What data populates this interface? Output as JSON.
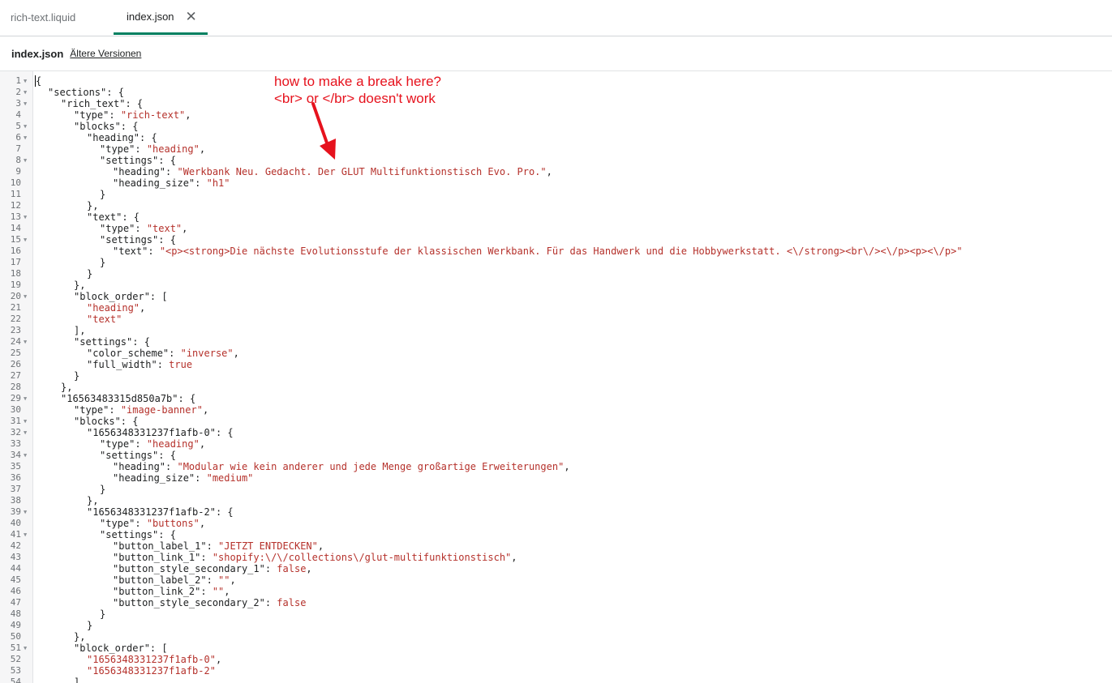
{
  "tabs": [
    {
      "label": "rich-text.liquid",
      "active": false
    },
    {
      "label": "index.json",
      "active": true,
      "close_icon": "close-icon"
    }
  ],
  "filebar": {
    "file_name": "index.json",
    "older_versions_link": "Ältere Versionen"
  },
  "annotation": {
    "line1": "how to make a break here?",
    "line2": "<br> or </br> doesn't work",
    "color": "#e6121d"
  },
  "editor": {
    "lines": [
      {
        "n": "1",
        "fold": true,
        "i": 0,
        "t": [
          [
            "p",
            "{"
          ]
        ]
      },
      {
        "n": "2",
        "fold": true,
        "i": 1,
        "t": [
          [
            "k",
            "\"sections\""
          ],
          [
            "p",
            ": {"
          ]
        ]
      },
      {
        "n": "3",
        "fold": true,
        "i": 2,
        "t": [
          [
            "k",
            "\"rich_text\""
          ],
          [
            "p",
            ": {"
          ]
        ]
      },
      {
        "n": "4",
        "fold": false,
        "i": 3,
        "t": [
          [
            "k",
            "\"type\""
          ],
          [
            "p",
            ": "
          ],
          [
            "s",
            "\"rich-text\""
          ],
          [
            "p",
            ","
          ]
        ]
      },
      {
        "n": "5",
        "fold": true,
        "i": 3,
        "t": [
          [
            "k",
            "\"blocks\""
          ],
          [
            "p",
            ": {"
          ]
        ]
      },
      {
        "n": "6",
        "fold": true,
        "i": 4,
        "t": [
          [
            "k",
            "\"heading\""
          ],
          [
            "p",
            ": {"
          ]
        ]
      },
      {
        "n": "7",
        "fold": false,
        "i": 5,
        "t": [
          [
            "k",
            "\"type\""
          ],
          [
            "p",
            ": "
          ],
          [
            "s",
            "\"heading\""
          ],
          [
            "p",
            ","
          ]
        ]
      },
      {
        "n": "8",
        "fold": true,
        "i": 5,
        "t": [
          [
            "k",
            "\"settings\""
          ],
          [
            "p",
            ": {"
          ]
        ]
      },
      {
        "n": "9",
        "fold": false,
        "i": 6,
        "t": [
          [
            "k",
            "\"heading\""
          ],
          [
            "p",
            ": "
          ],
          [
            "s",
            "\"Werkbank Neu. Gedacht. Der GLUT Multifunktionstisch Evo. Pro.\""
          ],
          [
            "p",
            ","
          ]
        ]
      },
      {
        "n": "10",
        "fold": false,
        "i": 6,
        "t": [
          [
            "k",
            "\"heading_size\""
          ],
          [
            "p",
            ": "
          ],
          [
            "s",
            "\"h1\""
          ]
        ]
      },
      {
        "n": "11",
        "fold": false,
        "i": 5,
        "t": [
          [
            "p",
            "}"
          ]
        ]
      },
      {
        "n": "12",
        "fold": false,
        "i": 4,
        "t": [
          [
            "p",
            "},"
          ]
        ]
      },
      {
        "n": "13",
        "fold": true,
        "i": 4,
        "t": [
          [
            "k",
            "\"text\""
          ],
          [
            "p",
            ": {"
          ]
        ]
      },
      {
        "n": "14",
        "fold": false,
        "i": 5,
        "t": [
          [
            "k",
            "\"type\""
          ],
          [
            "p",
            ": "
          ],
          [
            "s",
            "\"text\""
          ],
          [
            "p",
            ","
          ]
        ]
      },
      {
        "n": "15",
        "fold": true,
        "i": 5,
        "t": [
          [
            "k",
            "\"settings\""
          ],
          [
            "p",
            ": {"
          ]
        ]
      },
      {
        "n": "16",
        "fold": false,
        "i": 6,
        "t": [
          [
            "k",
            "\"text\""
          ],
          [
            "p",
            ": "
          ],
          [
            "s",
            "\"<p><strong>Die nächste Evolutionsstufe der klassischen Werkbank. Für das Handwerk und die Hobbywerkstatt. <\\/strong><br\\/><\\/p><p><\\/p>\""
          ]
        ]
      },
      {
        "n": "17",
        "fold": false,
        "i": 5,
        "t": [
          [
            "p",
            "}"
          ]
        ]
      },
      {
        "n": "18",
        "fold": false,
        "i": 4,
        "t": [
          [
            "p",
            "}"
          ]
        ]
      },
      {
        "n": "19",
        "fold": false,
        "i": 3,
        "t": [
          [
            "p",
            "},"
          ]
        ]
      },
      {
        "n": "20",
        "fold": true,
        "i": 3,
        "t": [
          [
            "k",
            "\"block_order\""
          ],
          [
            "p",
            ": ["
          ]
        ]
      },
      {
        "n": "21",
        "fold": false,
        "i": 4,
        "t": [
          [
            "s",
            "\"heading\""
          ],
          [
            "p",
            ","
          ]
        ]
      },
      {
        "n": "22",
        "fold": false,
        "i": 4,
        "t": [
          [
            "s",
            "\"text\""
          ]
        ]
      },
      {
        "n": "23",
        "fold": false,
        "i": 3,
        "t": [
          [
            "p",
            "],"
          ]
        ]
      },
      {
        "n": "24",
        "fold": true,
        "i": 3,
        "t": [
          [
            "k",
            "\"settings\""
          ],
          [
            "p",
            ": {"
          ]
        ]
      },
      {
        "n": "25",
        "fold": false,
        "i": 4,
        "t": [
          [
            "k",
            "\"color_scheme\""
          ],
          [
            "p",
            ": "
          ],
          [
            "s",
            "\"inverse\""
          ],
          [
            "p",
            ","
          ]
        ]
      },
      {
        "n": "26",
        "fold": false,
        "i": 4,
        "t": [
          [
            "k",
            "\"full_width\""
          ],
          [
            "p",
            ": "
          ],
          [
            "kw",
            "true"
          ]
        ]
      },
      {
        "n": "27",
        "fold": false,
        "i": 3,
        "t": [
          [
            "p",
            "}"
          ]
        ]
      },
      {
        "n": "28",
        "fold": false,
        "i": 2,
        "t": [
          [
            "p",
            "},"
          ]
        ]
      },
      {
        "n": "29",
        "fold": true,
        "i": 2,
        "t": [
          [
            "k",
            "\"16563483315d850a7b\""
          ],
          [
            "p",
            ": {"
          ]
        ]
      },
      {
        "n": "30",
        "fold": false,
        "i": 3,
        "t": [
          [
            "k",
            "\"type\""
          ],
          [
            "p",
            ": "
          ],
          [
            "s",
            "\"image-banner\""
          ],
          [
            "p",
            ","
          ]
        ]
      },
      {
        "n": "31",
        "fold": true,
        "i": 3,
        "t": [
          [
            "k",
            "\"blocks\""
          ],
          [
            "p",
            ": {"
          ]
        ]
      },
      {
        "n": "32",
        "fold": true,
        "i": 4,
        "t": [
          [
            "k",
            "\"1656348331237f1afb-0\""
          ],
          [
            "p",
            ": {"
          ]
        ]
      },
      {
        "n": "33",
        "fold": false,
        "i": 5,
        "t": [
          [
            "k",
            "\"type\""
          ],
          [
            "p",
            ": "
          ],
          [
            "s",
            "\"heading\""
          ],
          [
            "p",
            ","
          ]
        ]
      },
      {
        "n": "34",
        "fold": true,
        "i": 5,
        "t": [
          [
            "k",
            "\"settings\""
          ],
          [
            "p",
            ": {"
          ]
        ]
      },
      {
        "n": "35",
        "fold": false,
        "i": 6,
        "t": [
          [
            "k",
            "\"heading\""
          ],
          [
            "p",
            ": "
          ],
          [
            "s",
            "\"Modular wie kein anderer und jede Menge großartige Erweiterungen\""
          ],
          [
            "p",
            ","
          ]
        ]
      },
      {
        "n": "36",
        "fold": false,
        "i": 6,
        "t": [
          [
            "k",
            "\"heading_size\""
          ],
          [
            "p",
            ": "
          ],
          [
            "s",
            "\"medium\""
          ]
        ]
      },
      {
        "n": "37",
        "fold": false,
        "i": 5,
        "t": [
          [
            "p",
            "}"
          ]
        ]
      },
      {
        "n": "38",
        "fold": false,
        "i": 4,
        "t": [
          [
            "p",
            "},"
          ]
        ]
      },
      {
        "n": "39",
        "fold": true,
        "i": 4,
        "t": [
          [
            "k",
            "\"1656348331237f1afb-2\""
          ],
          [
            "p",
            ": {"
          ]
        ]
      },
      {
        "n": "40",
        "fold": false,
        "i": 5,
        "t": [
          [
            "k",
            "\"type\""
          ],
          [
            "p",
            ": "
          ],
          [
            "s",
            "\"buttons\""
          ],
          [
            "p",
            ","
          ]
        ]
      },
      {
        "n": "41",
        "fold": true,
        "i": 5,
        "t": [
          [
            "k",
            "\"settings\""
          ],
          [
            "p",
            ": {"
          ]
        ]
      },
      {
        "n": "42",
        "fold": false,
        "i": 6,
        "t": [
          [
            "k",
            "\"button_label_1\""
          ],
          [
            "p",
            ": "
          ],
          [
            "s",
            "\"JETZT ENTDECKEN\""
          ],
          [
            "p",
            ","
          ]
        ]
      },
      {
        "n": "43",
        "fold": false,
        "i": 6,
        "t": [
          [
            "k",
            "\"button_link_1\""
          ],
          [
            "p",
            ": "
          ],
          [
            "s",
            "\"shopify:\\/\\/collections\\/glut-multifunktionstisch\""
          ],
          [
            "p",
            ","
          ]
        ]
      },
      {
        "n": "44",
        "fold": false,
        "i": 6,
        "t": [
          [
            "k",
            "\"button_style_secondary_1\""
          ],
          [
            "p",
            ": "
          ],
          [
            "kw",
            "false"
          ],
          [
            "p",
            ","
          ]
        ]
      },
      {
        "n": "45",
        "fold": false,
        "i": 6,
        "t": [
          [
            "k",
            "\"button_label_2\""
          ],
          [
            "p",
            ": "
          ],
          [
            "s",
            "\"\""
          ],
          [
            "p",
            ","
          ]
        ]
      },
      {
        "n": "46",
        "fold": false,
        "i": 6,
        "t": [
          [
            "k",
            "\"button_link_2\""
          ],
          [
            "p",
            ": "
          ],
          [
            "s",
            "\"\""
          ],
          [
            "p",
            ","
          ]
        ]
      },
      {
        "n": "47",
        "fold": false,
        "i": 6,
        "t": [
          [
            "k",
            "\"button_style_secondary_2\""
          ],
          [
            "p",
            ": "
          ],
          [
            "kw",
            "false"
          ]
        ]
      },
      {
        "n": "48",
        "fold": false,
        "i": 5,
        "t": [
          [
            "p",
            "}"
          ]
        ]
      },
      {
        "n": "49",
        "fold": false,
        "i": 4,
        "t": [
          [
            "p",
            "}"
          ]
        ]
      },
      {
        "n": "50",
        "fold": false,
        "i": 3,
        "t": [
          [
            "p",
            "},"
          ]
        ]
      },
      {
        "n": "51",
        "fold": true,
        "i": 3,
        "t": [
          [
            "k",
            "\"block_order\""
          ],
          [
            "p",
            ": ["
          ]
        ]
      },
      {
        "n": "52",
        "fold": false,
        "i": 4,
        "t": [
          [
            "s",
            "\"1656348331237f1afb-0\""
          ],
          [
            "p",
            ","
          ]
        ]
      },
      {
        "n": "53",
        "fold": false,
        "i": 4,
        "t": [
          [
            "s",
            "\"1656348331237f1afb-2\""
          ]
        ]
      },
      {
        "n": "54",
        "fold": false,
        "i": 3,
        "t": [
          [
            "p",
            "]"
          ]
        ]
      }
    ]
  }
}
